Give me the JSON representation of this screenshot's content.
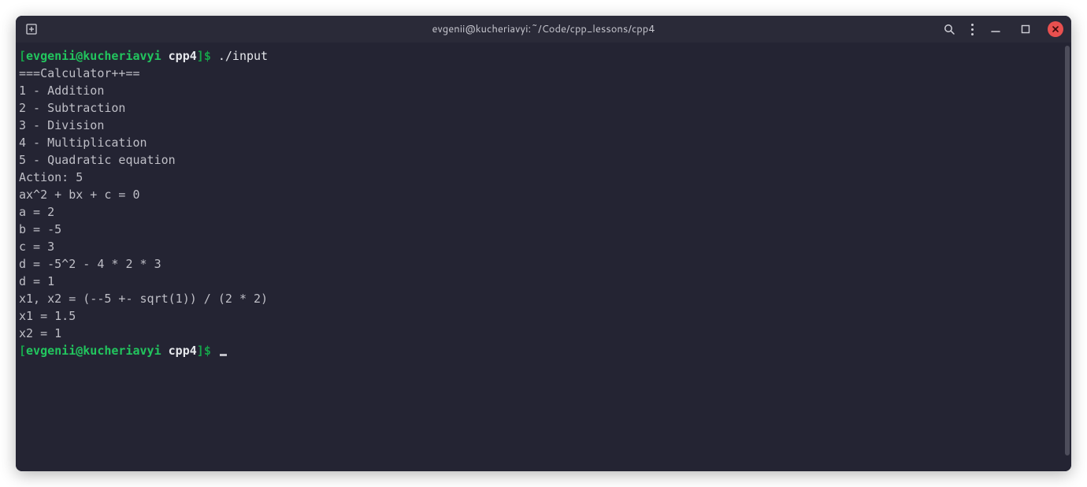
{
  "window": {
    "title": "evgenii@kucheriavyi:~/Code/cpp_lessons/cpp4"
  },
  "prompt": {
    "open": "[",
    "user": "evgenii",
    "at": "@",
    "host": "kucheriavyi",
    "space": " ",
    "dir": "cpp4",
    "close": "]",
    "symbol": "$"
  },
  "commands": {
    "first": "./input"
  },
  "output": {
    "lines": [
      "===Calculator++==",
      "1 - Addition",
      "2 - Subtraction",
      "3 - Division",
      "4 - Multiplication",
      "5 - Quadratic equation",
      "Action: 5",
      "ax^2 + bx + c = 0",
      "a = 2",
      "b = -5",
      "c = 3",
      "d = -5^2 - 4 * 2 * 3",
      "d = 1",
      "x1, x2 = (--5 +- sqrt(1)) / (2 * 2)",
      "x1 = 1.5",
      "x2 = 1"
    ]
  }
}
